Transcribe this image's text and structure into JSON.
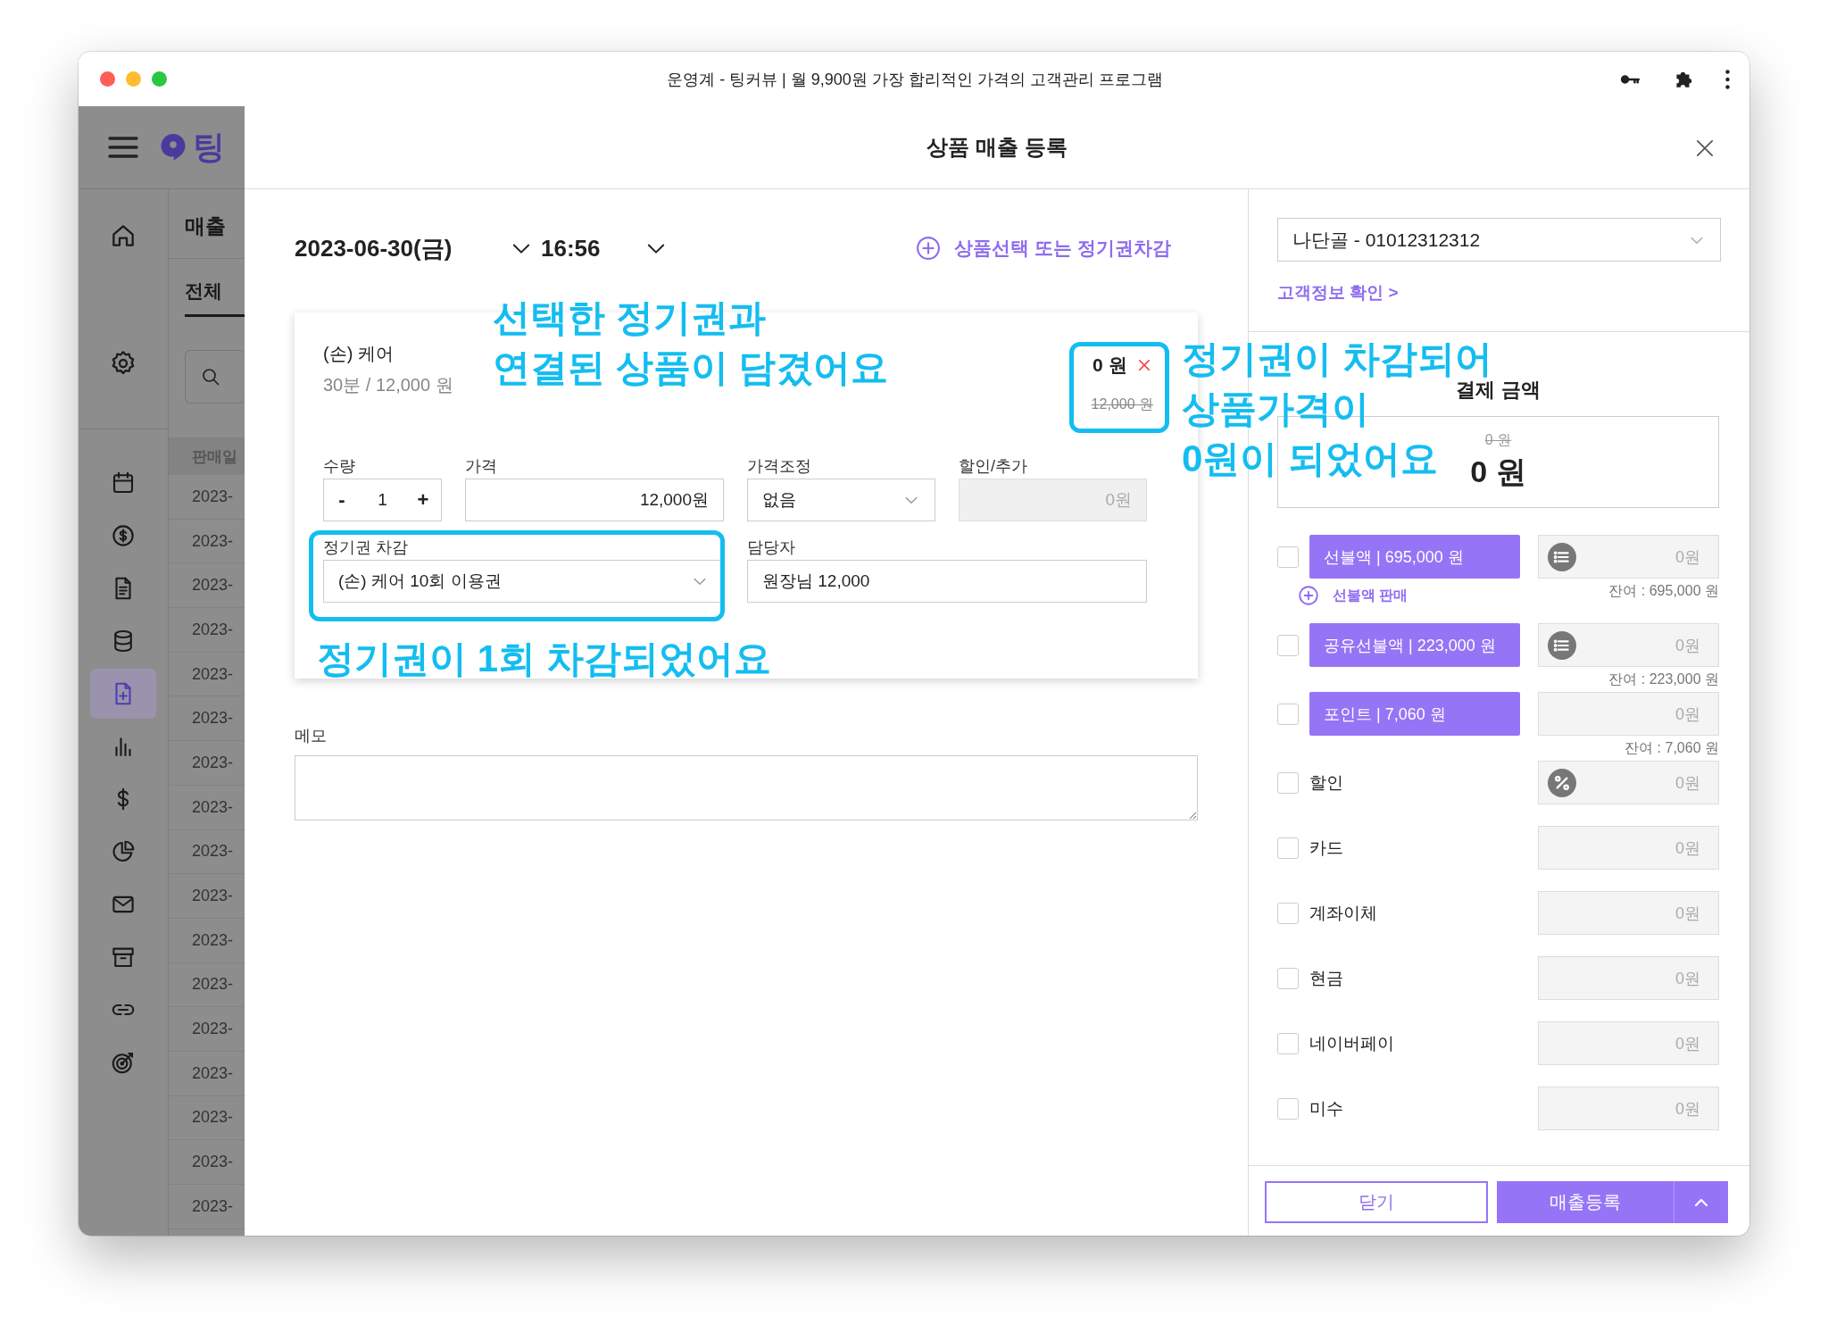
{
  "window": {
    "title": "운영계 - 팅커뷰 | 월 9,900원 가장 합리적인 가격의 고객관리 프로그램"
  },
  "background_app": {
    "logo_text": "팅",
    "page_title": "매출",
    "tab": "전체",
    "column": "판매일",
    "nav": [
      {
        "selected": false
      },
      {
        "selected": false
      },
      {
        "selected": false
      },
      {
        "selected": false
      },
      {
        "selected": false
      },
      {
        "selected": false
      },
      {
        "selected": true
      },
      {
        "selected": false
      },
      {
        "selected": false
      },
      {
        "selected": false
      },
      {
        "selected": false
      },
      {
        "selected": false
      },
      {
        "selected": false
      },
      {
        "selected": false
      }
    ],
    "rows": [
      "2023-",
      "2023-",
      "2023-",
      "2023-",
      "2023-",
      "2023-",
      "2023-",
      "2023-",
      "2023-",
      "2023-",
      "2023-",
      "2023-",
      "2023-",
      "2023-",
      "2023-",
      "2023-",
      "2023-"
    ]
  },
  "modal": {
    "title": "상품 매출 등록",
    "date": "2023-06-30(금)",
    "time": "16:56",
    "add_link": "상품선택 또는 정기권차감",
    "product": {
      "name": "(손) 케어",
      "detail": "30분 / 12,000 원",
      "price": "0 원",
      "original_price": "12,000 원"
    },
    "fields": [
      {
        "label": "수량",
        "kind": "stepper",
        "minus": "-",
        "value": "1",
        "plus": "+"
      },
      {
        "label": "가격",
        "kind": "input",
        "value": "12,000원",
        "disabled": false
      },
      {
        "label": "가격조정",
        "kind": "select",
        "value": "없음"
      },
      {
        "label": "할인/추가",
        "kind": "input",
        "value": "0원",
        "disabled": true
      },
      {
        "label": "정기권 차감",
        "kind": "select",
        "value": "(손) 케어 10회 이용권"
      },
      {
        "label": "담당자",
        "kind": "input",
        "value": "원장님 12,000",
        "disabled": false
      }
    ],
    "memo": {
      "label": "메모"
    },
    "annotations": [
      {
        "lines": [
          "선택한 정기권과",
          "연결된 상품이 담겼어요"
        ]
      },
      {
        "lines": [
          "정기권이 차감되어",
          "상품가격이",
          "0원이 되었어요"
        ]
      },
      {
        "lines": [
          "정기권이 1회 차감되었어요"
        ]
      }
    ],
    "customer": {
      "value": "나단골 - 01012312312",
      "link": "고객정보 확인 >"
    },
    "total": {
      "label": "결제 금액",
      "original": "0 원",
      "amount": "0 원"
    },
    "payments": [
      {
        "kind": "balance",
        "label": "선불액 | 695,000 원",
        "checked": false,
        "placeholder": "0원",
        "balance": "잔여 : 695,000 원",
        "action": "선불액 판매"
      },
      {
        "kind": "balance",
        "label": "공유선불액 | 223,000 원",
        "checked": false,
        "placeholder": "0원",
        "balance": "잔여 : 223,000 원"
      },
      {
        "kind": "points",
        "label": "포인트 | 7,060 원",
        "checked": false,
        "placeholder": "0원",
        "balance": "잔여 : 7,060 원"
      },
      {
        "kind": "discount",
        "label": "할인",
        "checked": false,
        "placeholder": "0원"
      },
      {
        "kind": "plain",
        "label": "카드",
        "checked": false,
        "placeholder": "0원"
      },
      {
        "kind": "plain",
        "label": "계좌이체",
        "checked": false,
        "placeholder": "0원"
      },
      {
        "kind": "plain",
        "label": "현금",
        "checked": false,
        "placeholder": "0원"
      },
      {
        "kind": "plain",
        "label": "네이버페이",
        "checked": false,
        "placeholder": "0원"
      },
      {
        "kind": "plain",
        "label": "미수",
        "checked": false,
        "placeholder": "0원"
      }
    ],
    "buttons": {
      "close": "닫기",
      "submit": "매출등록"
    }
  }
}
